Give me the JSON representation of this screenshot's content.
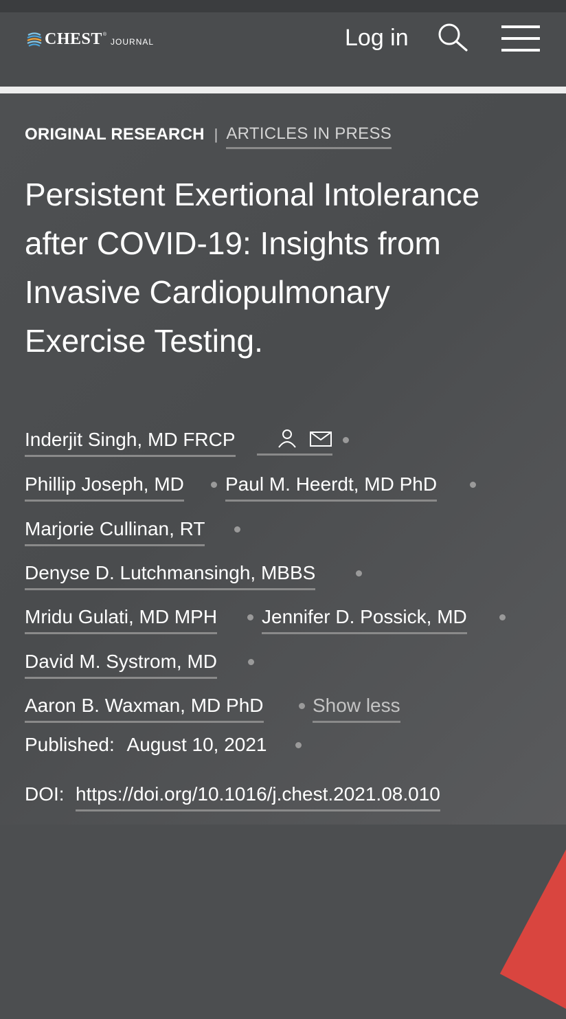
{
  "header": {
    "logo_name": "CHEST",
    "logo_tm": "®",
    "logo_sub": "JOURNAL",
    "login_label": "Log in",
    "search_icon": "search-icon",
    "menu_icon": "menu-icon"
  },
  "article": {
    "category": "ORIGINAL RESEARCH",
    "separator": "|",
    "status_link": "ARTICLES IN PRESS",
    "title": "Persistent Exertional Intolerance after COVID-19: Insights from Invasive Cardiopulmonary Exercise Testing.",
    "authors": [
      "Inderjit Singh, MD FRCP",
      "Phillip Joseph, MD",
      "Paul M. Heerdt, MD PhD",
      "Marjorie Cullinan, RT",
      "Denyse D. Lutchmansingh, MBBS",
      "Mridu Gulati, MD MPH",
      "Jennifer D. Possick, MD",
      "David M. Systrom, MD",
      "Aaron B. Waxman, MD PhD"
    ],
    "corresponding_author_icons": [
      "person-icon",
      "mail-icon"
    ],
    "show_less_label": "Show less",
    "published_label": "Published:",
    "published_date": "August 10, 2021",
    "doi_label": "DOI:",
    "doi_url": "https://doi.org/10.1016/j.chest.2021.08.010"
  },
  "colors": {
    "background": "#4c4e50",
    "text": "#ffffff",
    "muted_text": "#d4d4d4",
    "underline": "#8a8a8a",
    "accent_red": "#d9453f"
  }
}
